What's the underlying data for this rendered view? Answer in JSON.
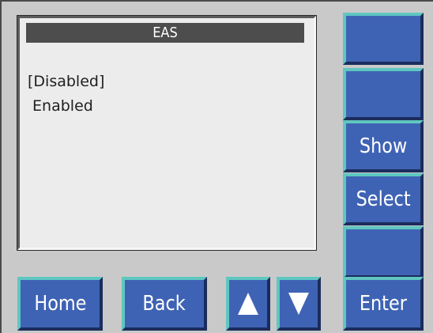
{
  "screen": {
    "title": "EAS",
    "options": [
      {
        "label": "[Disabled]",
        "selected": true
      },
      {
        "label": " Enabled",
        "selected": false
      }
    ]
  },
  "side_buttons": {
    "button_1": "",
    "button_2": "",
    "show": "Show",
    "select": "Select",
    "button_5": ""
  },
  "bottom_buttons": {
    "home": "Home",
    "back": "Back",
    "up_icon": "triangle-up",
    "down_icon": "triangle-down",
    "enter": "Enter"
  },
  "colors": {
    "button_face": "#3f63b4",
    "button_highlight": "#5fc6c0",
    "button_shadow": "#1b2c5c",
    "title_bar": "#4d4d4d",
    "screen_bg": "#ececec",
    "panel_bg": "#c9c9c9"
  }
}
